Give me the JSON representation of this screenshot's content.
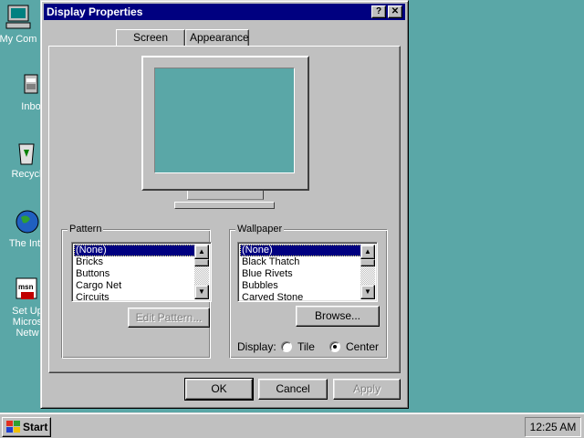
{
  "desktop": {
    "icons": [
      {
        "label": "My Com",
        "icon": "my-computer-icon"
      },
      {
        "label": "Inbo",
        "icon": "inbox-icon"
      },
      {
        "label": "Recycl",
        "icon": "recycle-bin-icon"
      },
      {
        "label": "The Inte",
        "icon": "internet-icon"
      },
      {
        "label": "Set Up\nMicros\nNetw",
        "icon": "msn-icon"
      }
    ]
  },
  "window": {
    "title": "Display Properties",
    "help_label": "?",
    "close_label": "✕",
    "tabs": [
      {
        "label": "Screen Saver"
      },
      {
        "label": "Appearance"
      }
    ]
  },
  "pattern": {
    "label": "Pattern",
    "items": [
      "(None)",
      "Bricks",
      "Buttons",
      "Cargo Net",
      "Circuits"
    ],
    "selected": "(None)",
    "edit_button": "Edit Pattern..."
  },
  "wallpaper": {
    "label": "Wallpaper",
    "items": [
      "(None)",
      "Black Thatch",
      "Blue Rivets",
      "Bubbles",
      "Carved Stone"
    ],
    "selected": "(None)",
    "browse_button": "Browse...",
    "display_label": "Display:",
    "options": [
      {
        "label": "Tile",
        "checked": false
      },
      {
        "label": "Center",
        "checked": true
      }
    ]
  },
  "buttons": {
    "ok": "OK",
    "cancel": "Cancel",
    "apply": "Apply"
  },
  "taskbar": {
    "start_label": "Start",
    "clock": "12:25 AM"
  },
  "colors": {
    "desktop": "#5aa7a7",
    "titlebar": "#000080",
    "face": "#c0c0c0"
  }
}
